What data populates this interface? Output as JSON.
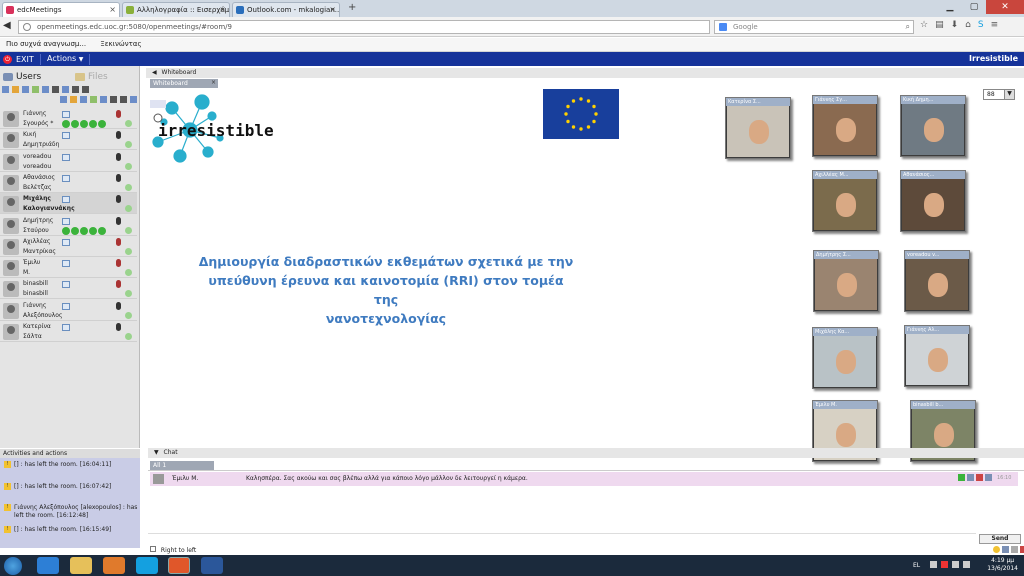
{
  "browser": {
    "tabs": [
      {
        "label": "edcMeetings",
        "color": "#d8315b"
      },
      {
        "label": "Αλληλογραφία :: Εισερχόμ...",
        "color": "#8ab03a"
      },
      {
        "label": "Outlook.com - mkalogian...",
        "color": "#2a6ebb"
      }
    ],
    "new_tab": "+",
    "url": "openmeetings.edc.uoc.gr:5080/openmeetings/#room/9",
    "search_engine": "Google",
    "bookmarks": [
      "Πιο συχνά αναγνωσμ...",
      "Ξεκινώντας"
    ]
  },
  "app": {
    "exit_label": "EXIT",
    "actions_label": "Actions",
    "room_title": "Irresistible"
  },
  "left_panel": {
    "tab_users": "Users",
    "tab_files": "Files",
    "users": [
      {
        "first": "Γιάννης",
        "last": "Σγουρός *",
        "bold": false,
        "checks": true,
        "mic": "red"
      },
      {
        "first": "Κική",
        "last": "Δημητριάδη",
        "bold": false,
        "checks": false,
        "mic": "dark"
      },
      {
        "first": "voreadou",
        "last": "voreadou",
        "bold": false,
        "checks": false,
        "mic": "dark"
      },
      {
        "first": "Αθανάσιος",
        "last": "Βελέτζας",
        "bold": false,
        "checks": false,
        "mic": "dark"
      },
      {
        "first": "Μιχάλης",
        "last": "Καλογιαννάκης",
        "bold": true,
        "checks": false,
        "mic": "dark"
      },
      {
        "first": "Δημήτρης",
        "last": "Σταύρου",
        "bold": false,
        "checks": true,
        "mic": "dark"
      },
      {
        "first": "Αχιλλέας",
        "last": "Μαντρίκας",
        "bold": false,
        "checks": false,
        "mic": "red"
      },
      {
        "first": "Έμιλυ",
        "last": "Μ.",
        "bold": false,
        "checks": false,
        "mic": "red"
      },
      {
        "first": "binasbill",
        "last": "binasbill",
        "bold": false,
        "checks": false,
        "mic": "red"
      },
      {
        "first": "Γιάννης",
        "last": "Αλεξόπουλος",
        "bold": false,
        "checks": false,
        "mic": "dark"
      },
      {
        "first": "Κατερίνα",
        "last": "Σάλτα",
        "bold": false,
        "checks": false,
        "mic": "dark"
      }
    ],
    "activities_title": "Activities and actions",
    "activities": [
      "[] : has left the room. [16:04:11]",
      "[] : has left the room. [16:07:42]",
      "Γιάννης Αλεξόπουλος [alexopoulos] : has left the room. [16:12:48]",
      "[] : has left the room. [16:15:49]"
    ]
  },
  "whiteboard": {
    "header": "Whiteboard",
    "tab_label": "Whiteboard",
    "logo_text": "irresistible",
    "main_text_lines": [
      "Δημιουργία διαδραστικών εκθεμάτων σχετικά με την",
      "υπεύθυνη έρευνα και καινοτομία (RRI) στον τομέα της",
      "νανοτεχνολογίας"
    ],
    "zoom": "88",
    "videos": [
      {
        "name": "Κατερίνα Σ..."
      },
      {
        "name": "Γιάννης Σγ..."
      },
      {
        "name": "Κική Δημη..."
      },
      {
        "name": "Αχιλλέας Μ..."
      },
      {
        "name": "Αθανάσιος..."
      },
      {
        "name": "Δημήτρης Σ..."
      },
      {
        "name": "voreadou v..."
      },
      {
        "name": "Μιχάλης Κα..."
      },
      {
        "name": "Γιάννης Αλ..."
      },
      {
        "name": "Έμιλυ Μ."
      },
      {
        "name": "binasbill b..."
      }
    ]
  },
  "chat": {
    "header": "Chat",
    "tab_label": "All 1",
    "message_author": "Έμιλυ Μ.",
    "message_text": "Καλησπέρα. Σας ακούω και σας βλέπω αλλά για κάποιο λόγο μάλλον δε λειτουργεί η κάμερα.",
    "message_time": "16:10",
    "rtl_label": "Right to left",
    "send_label": "Send"
  },
  "taskbar": {
    "lang": "EL",
    "time": "4:19 μμ",
    "date": "13/6/2014"
  }
}
